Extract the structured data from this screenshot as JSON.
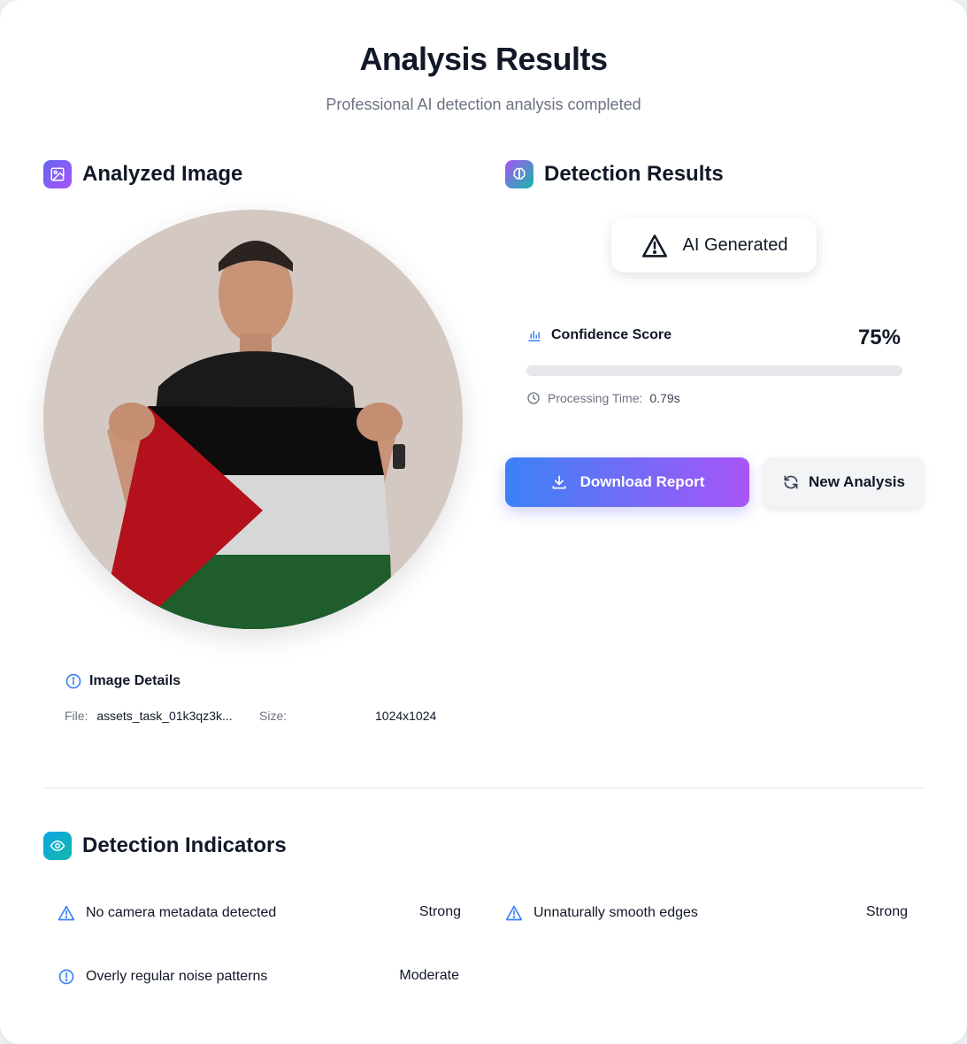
{
  "header": {
    "title": "Analysis Results",
    "subtitle": "Professional AI detection analysis completed"
  },
  "analyzed_image": {
    "section_title": "Analyzed Image",
    "details_title": "Image Details",
    "file_label": "File:",
    "file_value": "assets_task_01k3qz3k...",
    "size_label": "Size:",
    "size_value": "1024x1024"
  },
  "detection": {
    "section_title": "Detection Results",
    "verdict": "AI Generated",
    "confidence_label": "Confidence Score",
    "confidence_value": "75%",
    "confidence_bar_fill": 0,
    "processing_label": "Processing Time:",
    "processing_value": "0.79s"
  },
  "actions": {
    "download_label": "Download Report",
    "new_analysis_label": "New Analysis"
  },
  "indicators": {
    "section_title": "Detection Indicators",
    "items": [
      {
        "label": "No camera metadata detected",
        "strength": "Strong",
        "icon": "warning-triangle-icon"
      },
      {
        "label": "Unnaturally smooth edges",
        "strength": "Strong",
        "icon": "warning-triangle-icon"
      },
      {
        "label": "Overly regular noise patterns",
        "strength": "Moderate",
        "icon": "alert-circle-icon"
      }
    ]
  },
  "colors": {
    "accent_blue": "#3b82f6",
    "accent_purple": "#a855f7",
    "text_primary": "#111827",
    "text_muted": "#6b7280"
  }
}
